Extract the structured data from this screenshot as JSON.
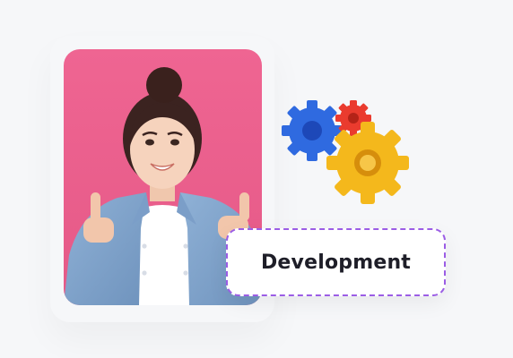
{
  "label": {
    "text": "Development"
  },
  "illustration": {
    "photo_subject": "person-thumbs-up",
    "icon": "gears-icon"
  },
  "colors": {
    "page_background": "#f6f7f9",
    "photo_background": "#ec5f8d",
    "label_border": "#9b5de5",
    "label_text": "#1e1e28",
    "gear_blue": "#2f6ae0",
    "gear_red": "#ea3b2e",
    "gear_yellow": "#f4b81c"
  }
}
